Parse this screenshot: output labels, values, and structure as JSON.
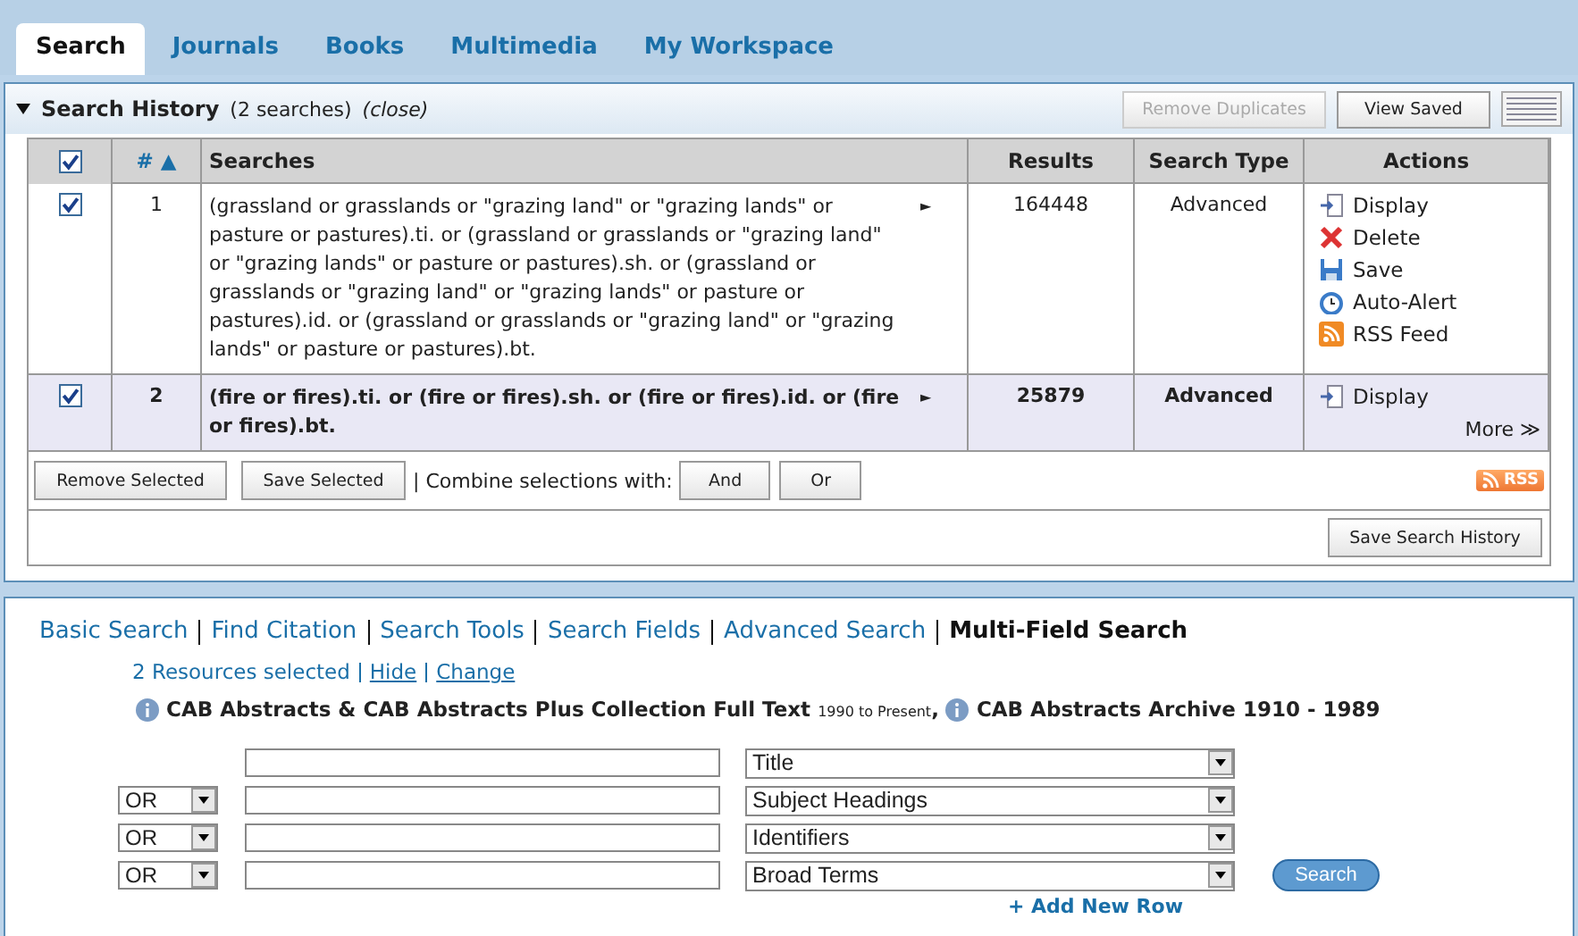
{
  "tabs": [
    {
      "label": "Search",
      "selected": true
    },
    {
      "label": "Journals",
      "selected": false
    },
    {
      "label": "Books",
      "selected": false
    },
    {
      "label": "Multimedia",
      "selected": false
    },
    {
      "label": "My Workspace",
      "selected": false
    }
  ],
  "history": {
    "title": "Search History",
    "count": "(2 searches)",
    "close": "(close)",
    "expanded": true,
    "buttons": [
      {
        "label": "Remove Duplicates",
        "disabled": true
      },
      {
        "label": "View Saved",
        "disabled": false
      }
    ],
    "columns": [
      {
        "label": "#",
        "sort": "▲"
      },
      {
        "label": "Searches"
      },
      {
        "label": "Results"
      },
      {
        "label": "Search Type"
      },
      {
        "label": "Actions"
      }
    ],
    "all_checked": true,
    "rows": [
      {
        "number": "1",
        "query": "(grassland or grasslands or \"grazing land\" or \"grazing lands\" or pasture or pastures).ti. or (grassland or grasslands or \"grazing land\" or \"grazing lands\" or pasture or pastures).sh. or (grassland or grasslands or \"grazing land\" or \"grazing lands\" or pasture or pastures).id. or (grassland or grasslands or \"grazing land\" or \"grazing lands\" or pasture or pastures).bt.",
        "arrow": "►",
        "results": "164448",
        "type": "Advanced",
        "checked": true,
        "selected": false,
        "actions": [
          {
            "kind": "display",
            "label": "Display"
          },
          {
            "kind": "delete",
            "label": "Delete"
          },
          {
            "kind": "save",
            "label": "Save"
          },
          {
            "kind": "alert",
            "label": "Auto-Alert"
          },
          {
            "kind": "rss",
            "label": "RSS Feed"
          }
        ]
      },
      {
        "number": "2",
        "query": "(fire or fires).ti. or (fire or fires).sh. or (fire or fires).id. or (fire or fires).bt.",
        "arrow": "►",
        "results": "25879",
        "type": "Advanced",
        "checked": true,
        "selected": true,
        "actions": [
          {
            "kind": "display",
            "label": "Display"
          }
        ],
        "more": "More ≫"
      }
    ],
    "footer": {
      "remove": "Remove Selected",
      "save": "Save Selected",
      "combine": "| Combine selections with:",
      "and": "And",
      "or": "Or",
      "rss": "RSS"
    },
    "save_history": "Save Search History"
  },
  "modes": [
    {
      "label": "Basic Search",
      "selected": false
    },
    {
      "label": "Find Citation",
      "selected": false
    },
    {
      "label": "Search Tools",
      "selected": false
    },
    {
      "label": "Search Fields",
      "selected": false
    },
    {
      "label": "Advanced Search",
      "selected": false
    },
    {
      "label": "Multi-Field Search",
      "selected": true
    }
  ],
  "resources": {
    "count": "2 Resources selected",
    "hide": "Hide",
    "change": "Change",
    "databases": [
      {
        "name": "CAB Abstracts & CAB Abstracts Plus Collection Full Text",
        "range": "1990 to Present",
        "sep": ","
      },
      {
        "name": "CAB Abstracts Archive 1910 - 1989"
      }
    ]
  },
  "fields": [
    {
      "field": "Title"
    },
    {
      "operator": "OR",
      "field": "Subject Headings"
    },
    {
      "operator": "OR",
      "field": "Identifiers"
    },
    {
      "operator": "OR",
      "field": "Broad Terms"
    }
  ],
  "search_button": "Search",
  "add_row": "+ Add New Row"
}
